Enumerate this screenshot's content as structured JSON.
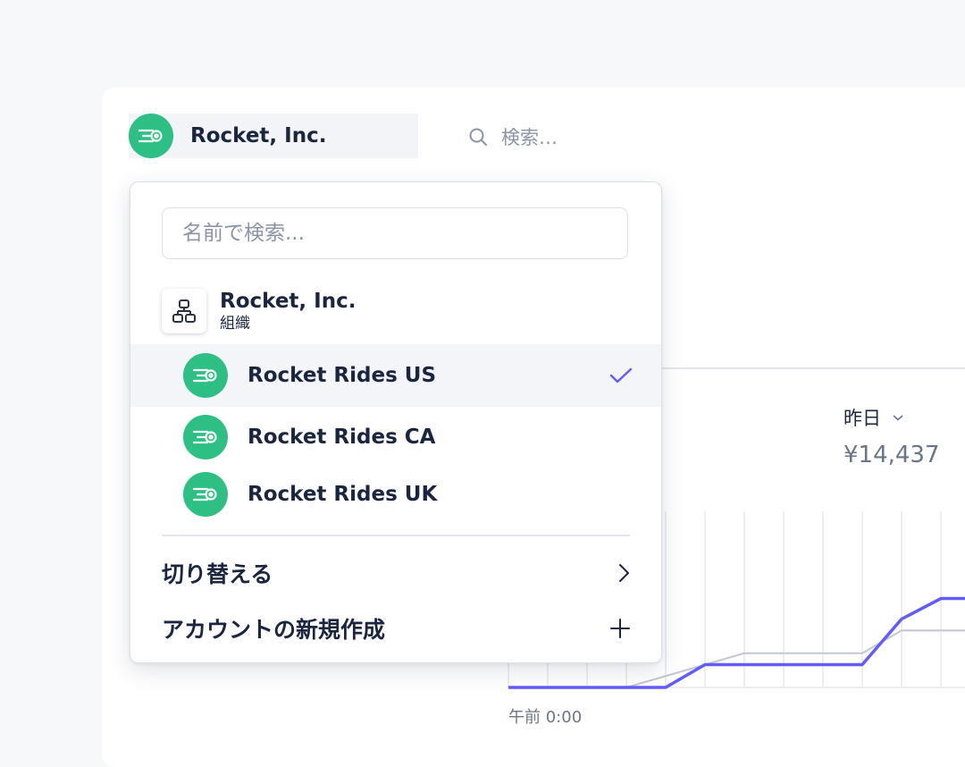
{
  "header": {
    "account_name": "Rocket, Inc.",
    "search_placeholder": "検索…"
  },
  "dropdown": {
    "search_placeholder": "名前で検索...",
    "org": {
      "name": "Rocket, Inc.",
      "type": "組織"
    },
    "accounts": [
      {
        "label": "Rocket Rides US",
        "selected": true
      },
      {
        "label": "Rocket Rides CA",
        "selected": false
      },
      {
        "label": "Rocket Rides UK",
        "selected": false
      }
    ],
    "switch_label": "切り替える",
    "create_label": "アカウントの新規作成"
  },
  "summary": {
    "period_label": "昨日",
    "value": "¥14,437"
  },
  "colors": {
    "brand_green": "#2dbf83",
    "accent_purple": "#635bff",
    "comparison_gray": "#c2c8d1"
  },
  "chart_data": {
    "type": "line",
    "x_tick_first": "午前 0:00",
    "series": [
      {
        "values": [
          0,
          0,
          0,
          0,
          0,
          1,
          1,
          1,
          1,
          1,
          3,
          3.9,
          3.9
        ]
      },
      {
        "values": [
          0,
          0,
          0,
          0,
          0.5,
          1,
          1.5,
          1.5,
          1.5,
          1.5,
          2.5,
          2.5,
          2.5
        ]
      }
    ],
    "grid": true
  }
}
